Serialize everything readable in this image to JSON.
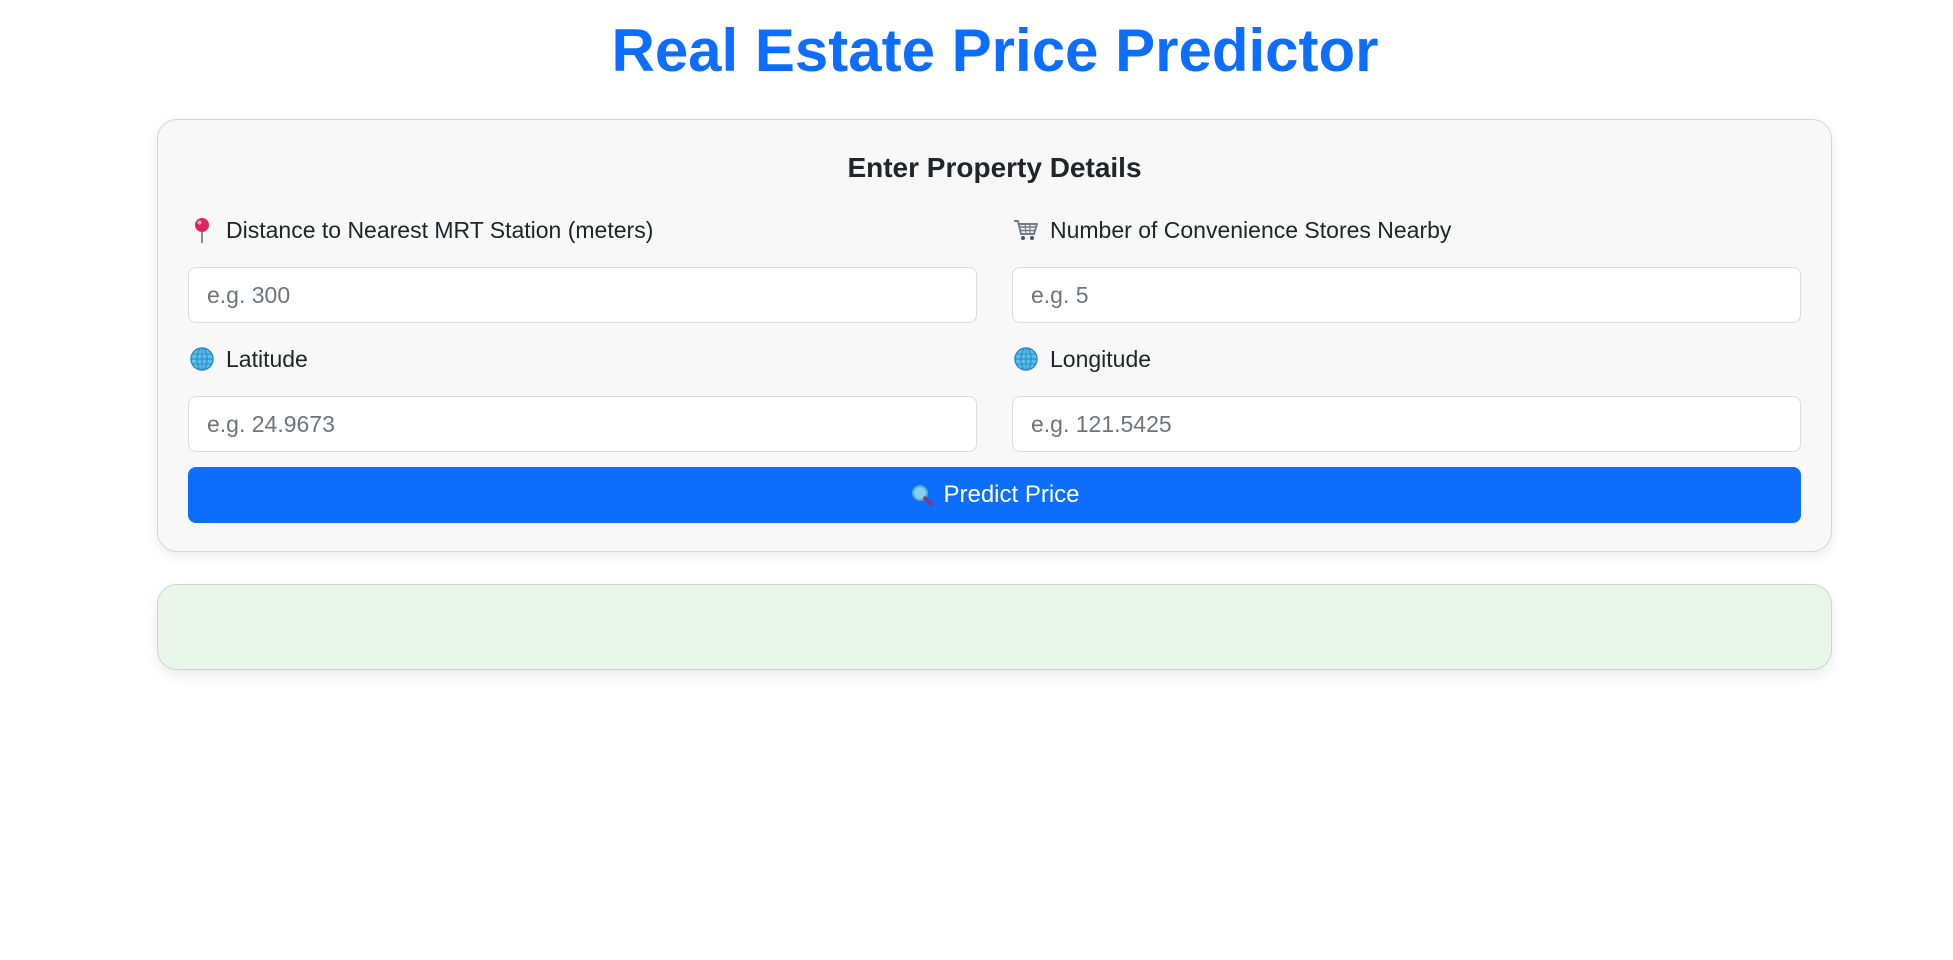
{
  "page": {
    "title": "Real Estate Price Predictor"
  },
  "form": {
    "heading": "Enter Property Details",
    "fields": [
      {
        "label": "Distance to Nearest MRT Station (meters)",
        "placeholder": "e.g. 300",
        "value": "",
        "icon": "pin-icon"
      },
      {
        "label": "Number of Convenience Stores Nearby",
        "placeholder": "e.g. 5",
        "value": "",
        "icon": "cart-icon"
      },
      {
        "label": "Latitude",
        "placeholder": "e.g. 24.9673",
        "value": "",
        "icon": "globe-icon"
      },
      {
        "label": "Longitude",
        "placeholder": "e.g. 121.5425",
        "value": "",
        "icon": "globe-icon"
      }
    ],
    "submit_label": "Predict Price",
    "submit_icon": "magnifier-icon"
  },
  "result": {
    "text": ""
  },
  "colors": {
    "accent": "#0d6efd",
    "card_bg": "#f8f8f8",
    "result_bg": "#eaf6ea"
  }
}
